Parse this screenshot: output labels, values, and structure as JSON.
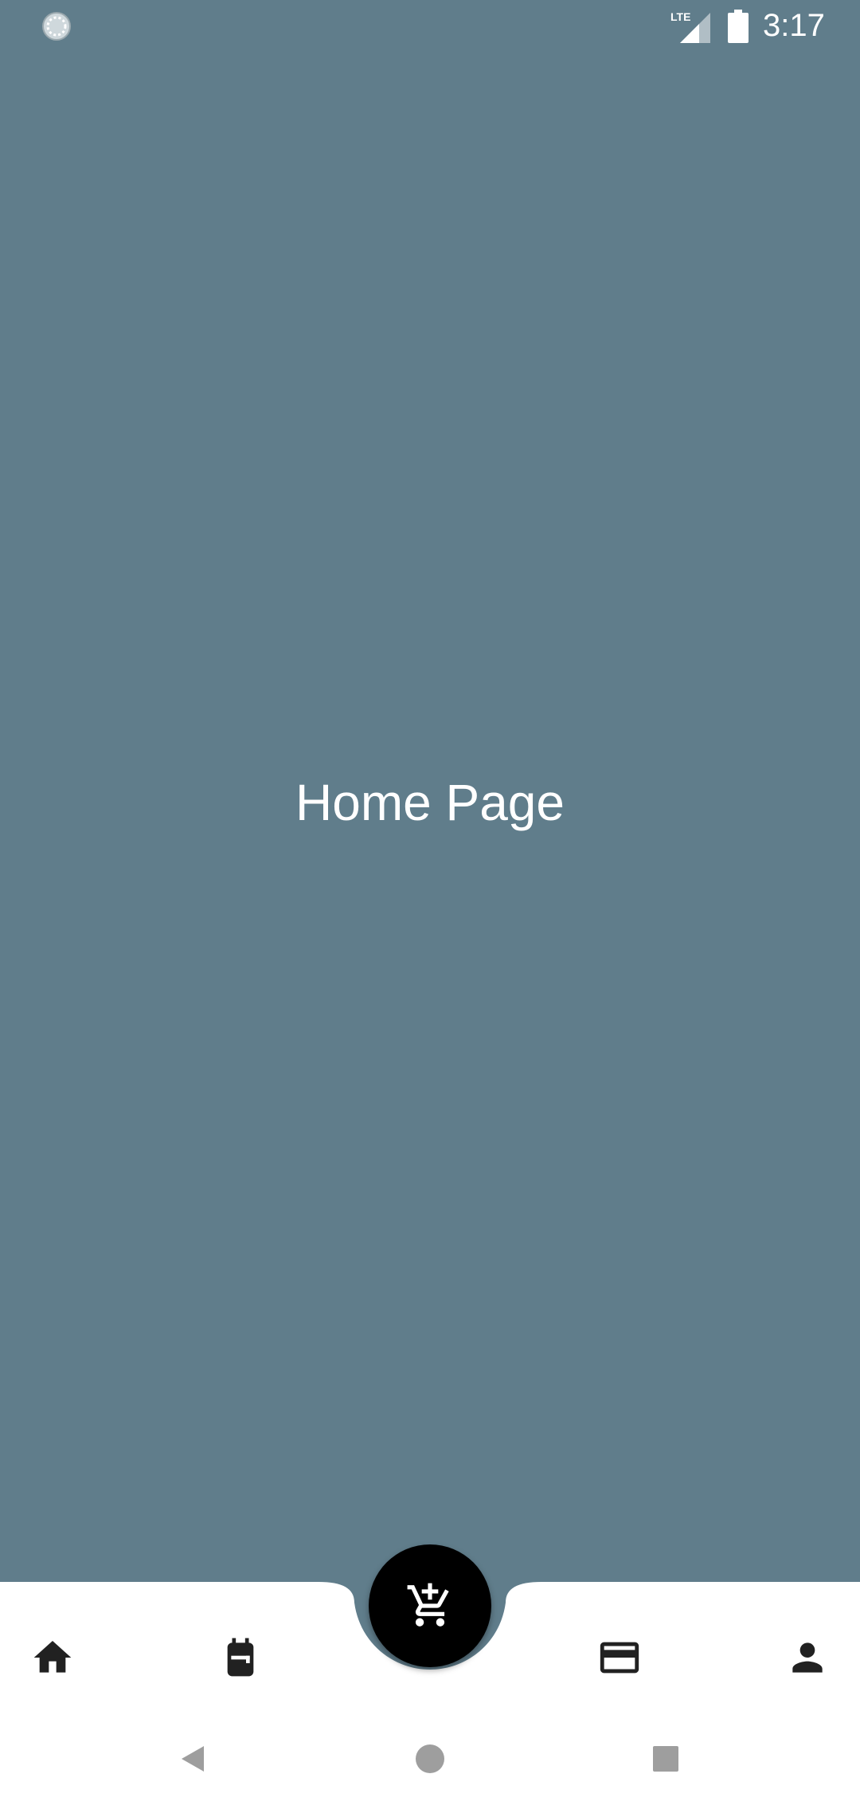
{
  "status_bar": {
    "time": "3:17",
    "network": "LTE",
    "icons": [
      "loading-icon",
      "lte-signal-icon",
      "battery-icon"
    ]
  },
  "main": {
    "title": "Home Page"
  },
  "bottom_nav": {
    "items": [
      {
        "icon": "home-icon"
      },
      {
        "icon": "backpack-icon"
      },
      {
        "icon": "credit-card-icon"
      },
      {
        "icon": "person-icon"
      }
    ],
    "fab": {
      "icon": "add-shopping-cart-icon"
    }
  },
  "system_nav": {
    "buttons": [
      "back-icon",
      "home-circle-icon",
      "recents-icon"
    ]
  },
  "colors": {
    "background": "#607d8b",
    "nav_background": "#ffffff",
    "fab": "#000000",
    "icon": "#212121"
  }
}
